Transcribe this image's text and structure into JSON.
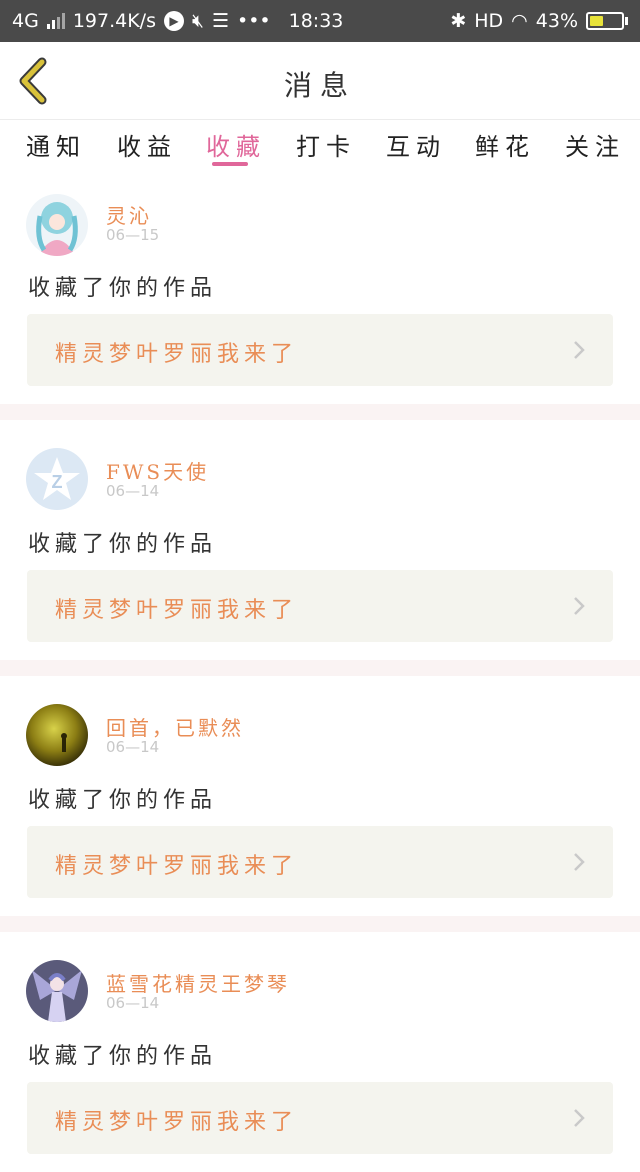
{
  "status_bar": {
    "network": "4G",
    "speed": "197.4K/s",
    "time": "18:33",
    "hd": "HD",
    "battery": "43%",
    "battery_level": 0.43,
    "icons": [
      "signal-icon",
      "play-icon",
      "mute-icon",
      "database-icon",
      "more-icon",
      "bluetooth-icon",
      "wifi-icon",
      "battery-icon"
    ]
  },
  "header": {
    "title": "消息",
    "back_icon": "back-chevron-icon"
  },
  "tabs": [
    {
      "label": "通知"
    },
    {
      "label": "收益"
    },
    {
      "label": "收藏",
      "active": true
    },
    {
      "label": "打卡"
    },
    {
      "label": "互动"
    },
    {
      "label": "鲜花"
    },
    {
      "label": "关注"
    }
  ],
  "messages": [
    {
      "user": "灵沁",
      "date": "06—15",
      "action": "收藏了你的作品",
      "work": "精灵梦叶罗丽我来了"
    },
    {
      "user": "FWS天使",
      "date": "06—14",
      "action": "收藏了你的作品",
      "work": "精灵梦叶罗丽我来了"
    },
    {
      "user": "回首，已默然",
      "date": "06—14",
      "action": "收藏了你的作品",
      "work": "精灵梦叶罗丽我来了"
    },
    {
      "user": "蓝雪花精灵王梦琴",
      "date": "06—14",
      "action": "收藏了你的作品",
      "work": "精灵梦叶罗丽我来了"
    }
  ],
  "colors": {
    "accent": "#e0679a",
    "name_orange": "#e98d56",
    "card_bg": "#f4f4ee",
    "separator": "#faf3f3",
    "back_icon": "#d9c23a"
  }
}
